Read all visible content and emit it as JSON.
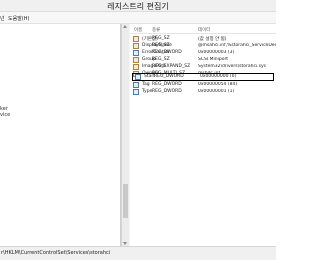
{
  "window": {
    "title": "레지스트리 편집기"
  },
  "menu": {
    "items": [
      "넌",
      "도움말(H)"
    ]
  },
  "tree": {
    "partial_labels": [
      "ker",
      "vice"
    ]
  },
  "list": {
    "headers": {
      "name": "이름",
      "type": "종류",
      "data": "데이터"
    },
    "rows": [
      {
        "name": "(기본값)",
        "type": "REG_SZ",
        "data": "(값 설정 안 됨)",
        "icon": "string-value-icon"
      },
      {
        "name": "DisplayName",
        "type": "REG_SZ",
        "data": "@msahci.inf,%storahci_ServiceDescription%",
        "icon": "string-value-icon"
      },
      {
        "name": "ErrorControl",
        "type": "REG_DWORD",
        "data": "0x00000003 (3)",
        "icon": "binary-value-icon"
      },
      {
        "name": "Group",
        "type": "REG_SZ",
        "data": "SCSI Miniport",
        "icon": "string-value-icon"
      },
      {
        "name": "ImagePath",
        "type": "REG_EXPAND_SZ",
        "data": "System32\\drivers\\storahci.sys",
        "icon": "string-value-icon"
      },
      {
        "name": "Owners",
        "type": "REG_MULTI_SZ",
        "data": "mshdc.inf",
        "icon": "string-value-icon"
      },
      {
        "name": "Start",
        "type": "REG_DWORD",
        "data": "0x00000000 (0)",
        "icon": "binary-value-icon"
      },
      {
        "name": "Tag",
        "type": "REG_DWORD",
        "data": "0x00000054 (84)",
        "icon": "binary-value-icon"
      },
      {
        "name": "Type",
        "type": "REG_DWORD",
        "data": "0x00000001 (1)",
        "icon": "binary-value-icon"
      }
    ]
  },
  "status": {
    "path": "r\\HKLM\\CurrentControlSet\\Services\\storahci"
  }
}
